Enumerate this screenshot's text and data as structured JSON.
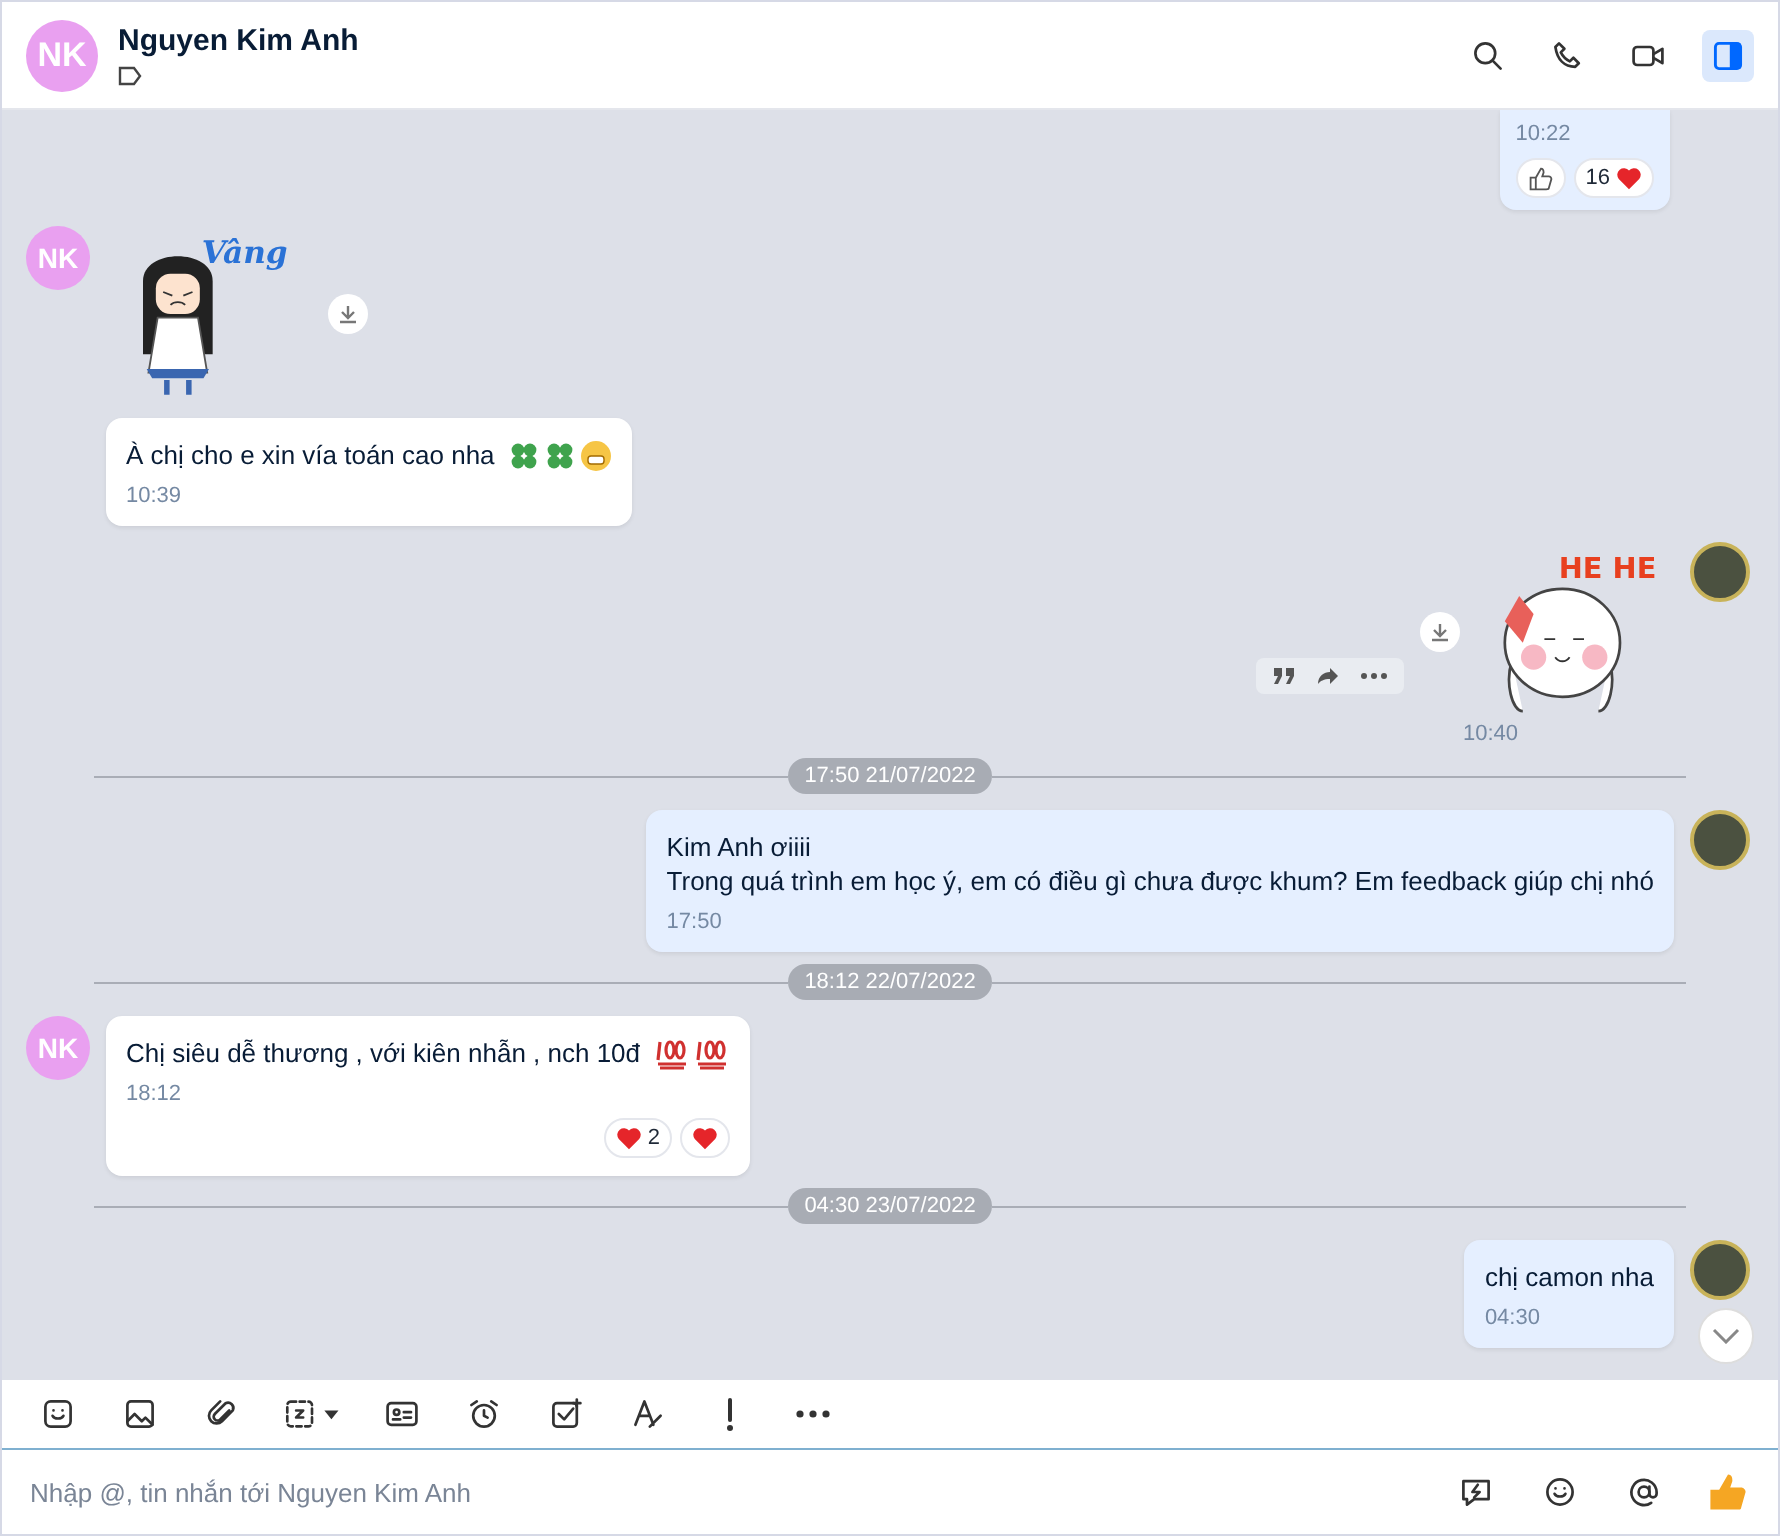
{
  "header": {
    "avatar": "NK",
    "name": "Nguyen Kim Anh",
    "actions": [
      {
        "kind": "search",
        "selected": false
      },
      {
        "kind": "phone",
        "selected": false
      },
      {
        "kind": "video",
        "selected": false
      },
      {
        "kind": "sidebar",
        "selected": true
      }
    ]
  },
  "messages": [
    {
      "kind": "sent_text",
      "cut_top": true,
      "time": "10:22",
      "reactions": [
        {
          "kind": "like"
        },
        {
          "kind": "heart",
          "count": "16",
          "count_first": true
        }
      ]
    },
    {
      "kind": "received_sticker",
      "avatar": "NK",
      "caption": "Vâng",
      "download": true
    },
    {
      "kind": "received_text",
      "text": "À chị cho e xin vía toán cao nha",
      "emojis": [
        {
          "kind": "clover"
        },
        {
          "kind": "clover"
        },
        {
          "kind": "grin"
        }
      ],
      "time": "10:39"
    },
    {
      "kind": "sent_sticker",
      "avatar_photo": true,
      "caption": "HE HE",
      "download": true,
      "hover_actions": [
        {
          "kind": "quote"
        },
        {
          "kind": "forward"
        },
        {
          "kind": "more"
        }
      ],
      "time": "10:40"
    },
    {
      "kind": "divider",
      "label": "17:50 21/07/2022"
    },
    {
      "kind": "sent_text",
      "avatar_photo": true,
      "lines": [
        "Kim Anh ơiiii",
        "Trong quá trình em học ý, em có điều gì chưa được khum? Em feedback giúp chị nhó"
      ],
      "time": "17:50"
    },
    {
      "kind": "divider",
      "label": "18:12 22/07/2022"
    },
    {
      "kind": "received_text",
      "avatar": "NK",
      "text": "Chị siêu dễ thương , với kiên nhẫn , nch 10đ",
      "emojis": [
        {
          "kind": "hundred"
        },
        {
          "kind": "hundred"
        }
      ],
      "time": "18:12",
      "reactions": [
        {
          "kind": "heart",
          "count": "2",
          "count_first": false
        },
        {
          "kind": "heart"
        }
      ]
    },
    {
      "kind": "divider",
      "label": "04:30 23/07/2022"
    },
    {
      "kind": "sent_text",
      "avatar_photo": true,
      "text": "chị camon nha",
      "time": "04:30"
    }
  ],
  "scroll_down_button": true,
  "toolbar": [
    {
      "kind": "sticker"
    },
    {
      "kind": "image"
    },
    {
      "kind": "attach"
    },
    {
      "kind": "screenshot"
    },
    {
      "kind": "contact-card"
    },
    {
      "kind": "reminder"
    },
    {
      "kind": "task"
    },
    {
      "kind": "format"
    },
    {
      "kind": "important"
    },
    {
      "kind": "more"
    }
  ],
  "composer": {
    "placeholder": "Nhập @, tin nhắn tới Nguyen Kim Anh",
    "actions": [
      {
        "kind": "quick-message"
      },
      {
        "kind": "emoji"
      },
      {
        "kind": "mention"
      },
      {
        "kind": "like"
      }
    ]
  }
}
